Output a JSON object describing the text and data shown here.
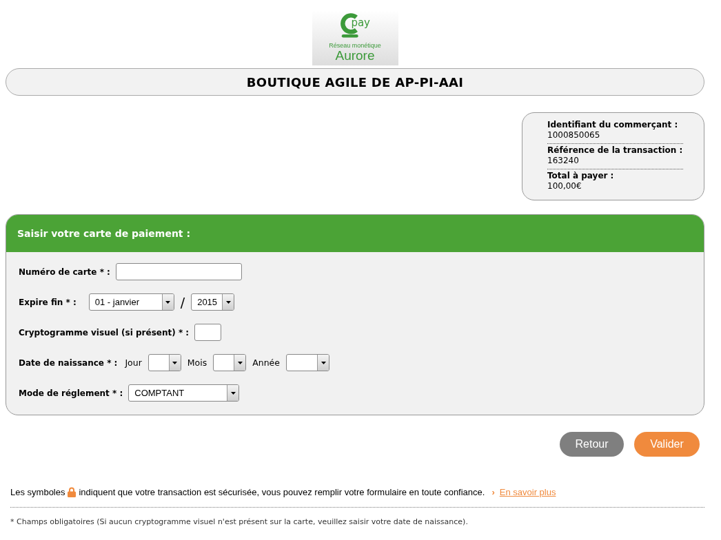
{
  "logo": {
    "mark": "pay",
    "tagline": "Réseau monétique",
    "name": "Aurore"
  },
  "shop_title": "BOUTIQUE AGILE DE AP-PI-AAI",
  "merchant_info": [
    {
      "label": "Identifiant du commerçant :",
      "value": "1000850065"
    },
    {
      "label": "Référence de la transaction :",
      "value": "163240"
    },
    {
      "label": "Total à payer :",
      "value": "100,00€"
    }
  ],
  "payment_form": {
    "title": "Saisir votre carte de paiement :",
    "fields": [
      {
        "kind": "input",
        "label": "Numéro de carte * :"
      },
      {
        "kind": "expiry",
        "label": "Expire fin * :",
        "month": "01 - janvier",
        "separator": "/",
        "year": "2015"
      },
      {
        "kind": "short-input",
        "label": "Cryptogramme visuel (si présent) * :"
      },
      {
        "kind": "birthdate",
        "label": "Date de naissance * :",
        "parts": [
          "Jour",
          "Mois",
          "Année"
        ]
      },
      {
        "kind": "select",
        "label": "Mode de réglement * :",
        "value": "COMPTANT"
      }
    ]
  },
  "buttons": [
    {
      "label": "Retour",
      "kind": "secondary"
    },
    {
      "label": "Valider",
      "kind": "primary"
    }
  ],
  "security_note": {
    "before": "Les symboles",
    "after": "indiquent que votre transaction est sécurisée, vous pouvez remplir votre formulaire en toute confiance.",
    "link_marker": "›",
    "link": "En savoir plus"
  },
  "footnote": "* Champs obligatoires (Si aucun cryptogramme visuel n'est présent sur la carte, veuillez saisir votre date de naissance)."
}
